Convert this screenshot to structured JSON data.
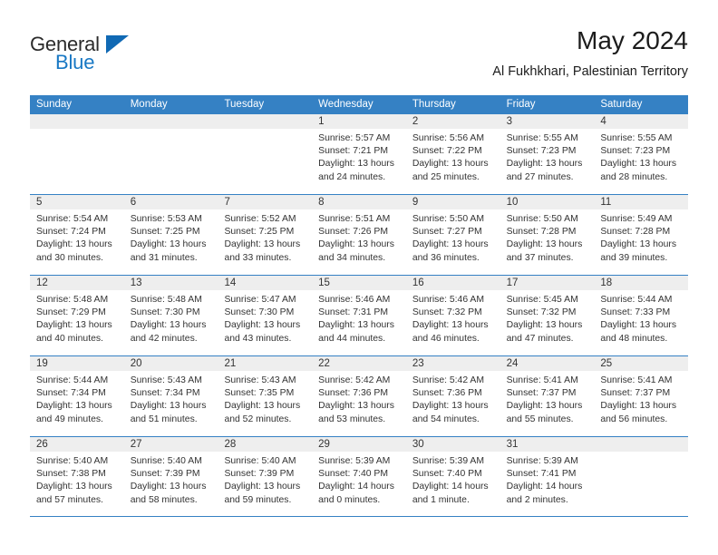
{
  "brand": {
    "word_one": "General",
    "word_two": "Blue",
    "triangle_icon": "brand-triangle-icon"
  },
  "header": {
    "title": "May 2024",
    "subtitle": "Al Fukhkhari, Palestinian Territory"
  },
  "colors": {
    "header_blue": "#3581c4",
    "brand_blue": "#1878c4",
    "day_strip_gray": "#eeeeee",
    "text": "#333333"
  },
  "calendar": {
    "weekday_headers": [
      "Sunday",
      "Monday",
      "Tuesday",
      "Wednesday",
      "Thursday",
      "Friday",
      "Saturday"
    ],
    "weeks": [
      [
        {
          "day": "",
          "empty": true,
          "sunrise": "",
          "sunset": "",
          "daylight_1": "",
          "daylight_2": ""
        },
        {
          "day": "",
          "empty": true,
          "sunrise": "",
          "sunset": "",
          "daylight_1": "",
          "daylight_2": ""
        },
        {
          "day": "",
          "empty": true,
          "sunrise": "",
          "sunset": "",
          "daylight_1": "",
          "daylight_2": ""
        },
        {
          "day": "1",
          "empty": false,
          "sunrise": "Sunrise: 5:57 AM",
          "sunset": "Sunset: 7:21 PM",
          "daylight_1": "Daylight: 13 hours",
          "daylight_2": "and 24 minutes."
        },
        {
          "day": "2",
          "empty": false,
          "sunrise": "Sunrise: 5:56 AM",
          "sunset": "Sunset: 7:22 PM",
          "daylight_1": "Daylight: 13 hours",
          "daylight_2": "and 25 minutes."
        },
        {
          "day": "3",
          "empty": false,
          "sunrise": "Sunrise: 5:55 AM",
          "sunset": "Sunset: 7:23 PM",
          "daylight_1": "Daylight: 13 hours",
          "daylight_2": "and 27 minutes."
        },
        {
          "day": "4",
          "empty": false,
          "sunrise": "Sunrise: 5:55 AM",
          "sunset": "Sunset: 7:23 PM",
          "daylight_1": "Daylight: 13 hours",
          "daylight_2": "and 28 minutes."
        }
      ],
      [
        {
          "day": "5",
          "empty": false,
          "sunrise": "Sunrise: 5:54 AM",
          "sunset": "Sunset: 7:24 PM",
          "daylight_1": "Daylight: 13 hours",
          "daylight_2": "and 30 minutes."
        },
        {
          "day": "6",
          "empty": false,
          "sunrise": "Sunrise: 5:53 AM",
          "sunset": "Sunset: 7:25 PM",
          "daylight_1": "Daylight: 13 hours",
          "daylight_2": "and 31 minutes."
        },
        {
          "day": "7",
          "empty": false,
          "sunrise": "Sunrise: 5:52 AM",
          "sunset": "Sunset: 7:25 PM",
          "daylight_1": "Daylight: 13 hours",
          "daylight_2": "and 33 minutes."
        },
        {
          "day": "8",
          "empty": false,
          "sunrise": "Sunrise: 5:51 AM",
          "sunset": "Sunset: 7:26 PM",
          "daylight_1": "Daylight: 13 hours",
          "daylight_2": "and 34 minutes."
        },
        {
          "day": "9",
          "empty": false,
          "sunrise": "Sunrise: 5:50 AM",
          "sunset": "Sunset: 7:27 PM",
          "daylight_1": "Daylight: 13 hours",
          "daylight_2": "and 36 minutes."
        },
        {
          "day": "10",
          "empty": false,
          "sunrise": "Sunrise: 5:50 AM",
          "sunset": "Sunset: 7:28 PM",
          "daylight_1": "Daylight: 13 hours",
          "daylight_2": "and 37 minutes."
        },
        {
          "day": "11",
          "empty": false,
          "sunrise": "Sunrise: 5:49 AM",
          "sunset": "Sunset: 7:28 PM",
          "daylight_1": "Daylight: 13 hours",
          "daylight_2": "and 39 minutes."
        }
      ],
      [
        {
          "day": "12",
          "empty": false,
          "sunrise": "Sunrise: 5:48 AM",
          "sunset": "Sunset: 7:29 PM",
          "daylight_1": "Daylight: 13 hours",
          "daylight_2": "and 40 minutes."
        },
        {
          "day": "13",
          "empty": false,
          "sunrise": "Sunrise: 5:48 AM",
          "sunset": "Sunset: 7:30 PM",
          "daylight_1": "Daylight: 13 hours",
          "daylight_2": "and 42 minutes."
        },
        {
          "day": "14",
          "empty": false,
          "sunrise": "Sunrise: 5:47 AM",
          "sunset": "Sunset: 7:30 PM",
          "daylight_1": "Daylight: 13 hours",
          "daylight_2": "and 43 minutes."
        },
        {
          "day": "15",
          "empty": false,
          "sunrise": "Sunrise: 5:46 AM",
          "sunset": "Sunset: 7:31 PM",
          "daylight_1": "Daylight: 13 hours",
          "daylight_2": "and 44 minutes."
        },
        {
          "day": "16",
          "empty": false,
          "sunrise": "Sunrise: 5:46 AM",
          "sunset": "Sunset: 7:32 PM",
          "daylight_1": "Daylight: 13 hours",
          "daylight_2": "and 46 minutes."
        },
        {
          "day": "17",
          "empty": false,
          "sunrise": "Sunrise: 5:45 AM",
          "sunset": "Sunset: 7:32 PM",
          "daylight_1": "Daylight: 13 hours",
          "daylight_2": "and 47 minutes."
        },
        {
          "day": "18",
          "empty": false,
          "sunrise": "Sunrise: 5:44 AM",
          "sunset": "Sunset: 7:33 PM",
          "daylight_1": "Daylight: 13 hours",
          "daylight_2": "and 48 minutes."
        }
      ],
      [
        {
          "day": "19",
          "empty": false,
          "sunrise": "Sunrise: 5:44 AM",
          "sunset": "Sunset: 7:34 PM",
          "daylight_1": "Daylight: 13 hours",
          "daylight_2": "and 49 minutes."
        },
        {
          "day": "20",
          "empty": false,
          "sunrise": "Sunrise: 5:43 AM",
          "sunset": "Sunset: 7:34 PM",
          "daylight_1": "Daylight: 13 hours",
          "daylight_2": "and 51 minutes."
        },
        {
          "day": "21",
          "empty": false,
          "sunrise": "Sunrise: 5:43 AM",
          "sunset": "Sunset: 7:35 PM",
          "daylight_1": "Daylight: 13 hours",
          "daylight_2": "and 52 minutes."
        },
        {
          "day": "22",
          "empty": false,
          "sunrise": "Sunrise: 5:42 AM",
          "sunset": "Sunset: 7:36 PM",
          "daylight_1": "Daylight: 13 hours",
          "daylight_2": "and 53 minutes."
        },
        {
          "day": "23",
          "empty": false,
          "sunrise": "Sunrise: 5:42 AM",
          "sunset": "Sunset: 7:36 PM",
          "daylight_1": "Daylight: 13 hours",
          "daylight_2": "and 54 minutes."
        },
        {
          "day": "24",
          "empty": false,
          "sunrise": "Sunrise: 5:41 AM",
          "sunset": "Sunset: 7:37 PM",
          "daylight_1": "Daylight: 13 hours",
          "daylight_2": "and 55 minutes."
        },
        {
          "day": "25",
          "empty": false,
          "sunrise": "Sunrise: 5:41 AM",
          "sunset": "Sunset: 7:37 PM",
          "daylight_1": "Daylight: 13 hours",
          "daylight_2": "and 56 minutes."
        }
      ],
      [
        {
          "day": "26",
          "empty": false,
          "sunrise": "Sunrise: 5:40 AM",
          "sunset": "Sunset: 7:38 PM",
          "daylight_1": "Daylight: 13 hours",
          "daylight_2": "and 57 minutes."
        },
        {
          "day": "27",
          "empty": false,
          "sunrise": "Sunrise: 5:40 AM",
          "sunset": "Sunset: 7:39 PM",
          "daylight_1": "Daylight: 13 hours",
          "daylight_2": "and 58 minutes."
        },
        {
          "day": "28",
          "empty": false,
          "sunrise": "Sunrise: 5:40 AM",
          "sunset": "Sunset: 7:39 PM",
          "daylight_1": "Daylight: 13 hours",
          "daylight_2": "and 59 minutes."
        },
        {
          "day": "29",
          "empty": false,
          "sunrise": "Sunrise: 5:39 AM",
          "sunset": "Sunset: 7:40 PM",
          "daylight_1": "Daylight: 14 hours",
          "daylight_2": "and 0 minutes."
        },
        {
          "day": "30",
          "empty": false,
          "sunrise": "Sunrise: 5:39 AM",
          "sunset": "Sunset: 7:40 PM",
          "daylight_1": "Daylight: 14 hours",
          "daylight_2": "and 1 minute."
        },
        {
          "day": "31",
          "empty": false,
          "sunrise": "Sunrise: 5:39 AM",
          "sunset": "Sunset: 7:41 PM",
          "daylight_1": "Daylight: 14 hours",
          "daylight_2": "and 2 minutes."
        },
        {
          "day": "",
          "empty": true,
          "sunrise": "",
          "sunset": "",
          "daylight_1": "",
          "daylight_2": ""
        }
      ]
    ]
  }
}
